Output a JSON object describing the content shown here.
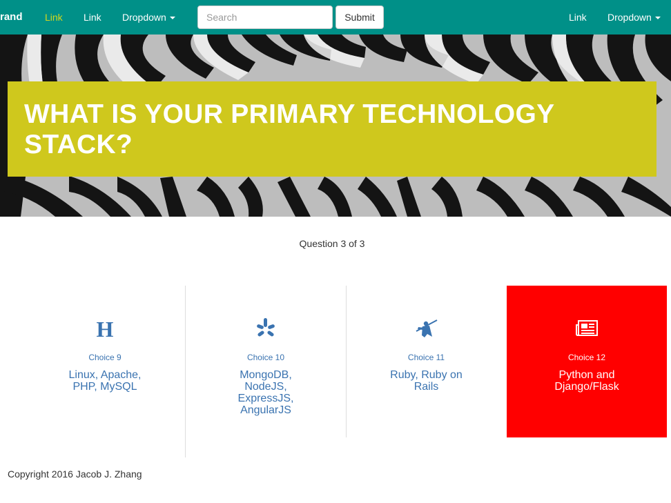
{
  "navbar": {
    "brand": "rand",
    "left_links": [
      "Link",
      "Link"
    ],
    "left_dropdown": "Dropdown",
    "search": {
      "placeholder": "Search",
      "value": ""
    },
    "submit_label": "Submit",
    "right_link": "Link",
    "right_dropdown": "Dropdown",
    "colors": {
      "background": "#009088",
      "active_link": "#d4d81c"
    }
  },
  "hero": {
    "image": "zebra-stripes-photo",
    "title": "WHAT IS YOUR PRIMARY TECHNOLOGY STACK?",
    "title_background": "#cfc81d"
  },
  "question_progress": "Question 3 of 3",
  "choices": [
    {
      "icon": "letter-h-icon",
      "number": "Choice 9",
      "label": "Linux, Apache, PHP, MySQL",
      "selected": false
    },
    {
      "icon": "yelp-burst-icon",
      "number": "Choice 10",
      "label": "MongoDB, NodeJS, ExpressJS, AngularJS",
      "selected": false
    },
    {
      "icon": "samurai-icon",
      "number": "Choice 11",
      "label": "Ruby, Ruby on Rails",
      "selected": false
    },
    {
      "icon": "newspaper-icon",
      "number": "Choice 12",
      "label": "Python and Django/Flask",
      "selected": true
    }
  ],
  "colors": {
    "choice_text": "#3a73b0",
    "selected_background": "#ff0000"
  },
  "footer": {
    "copyright": "Copyright 2016 Jacob J. Zhang"
  }
}
